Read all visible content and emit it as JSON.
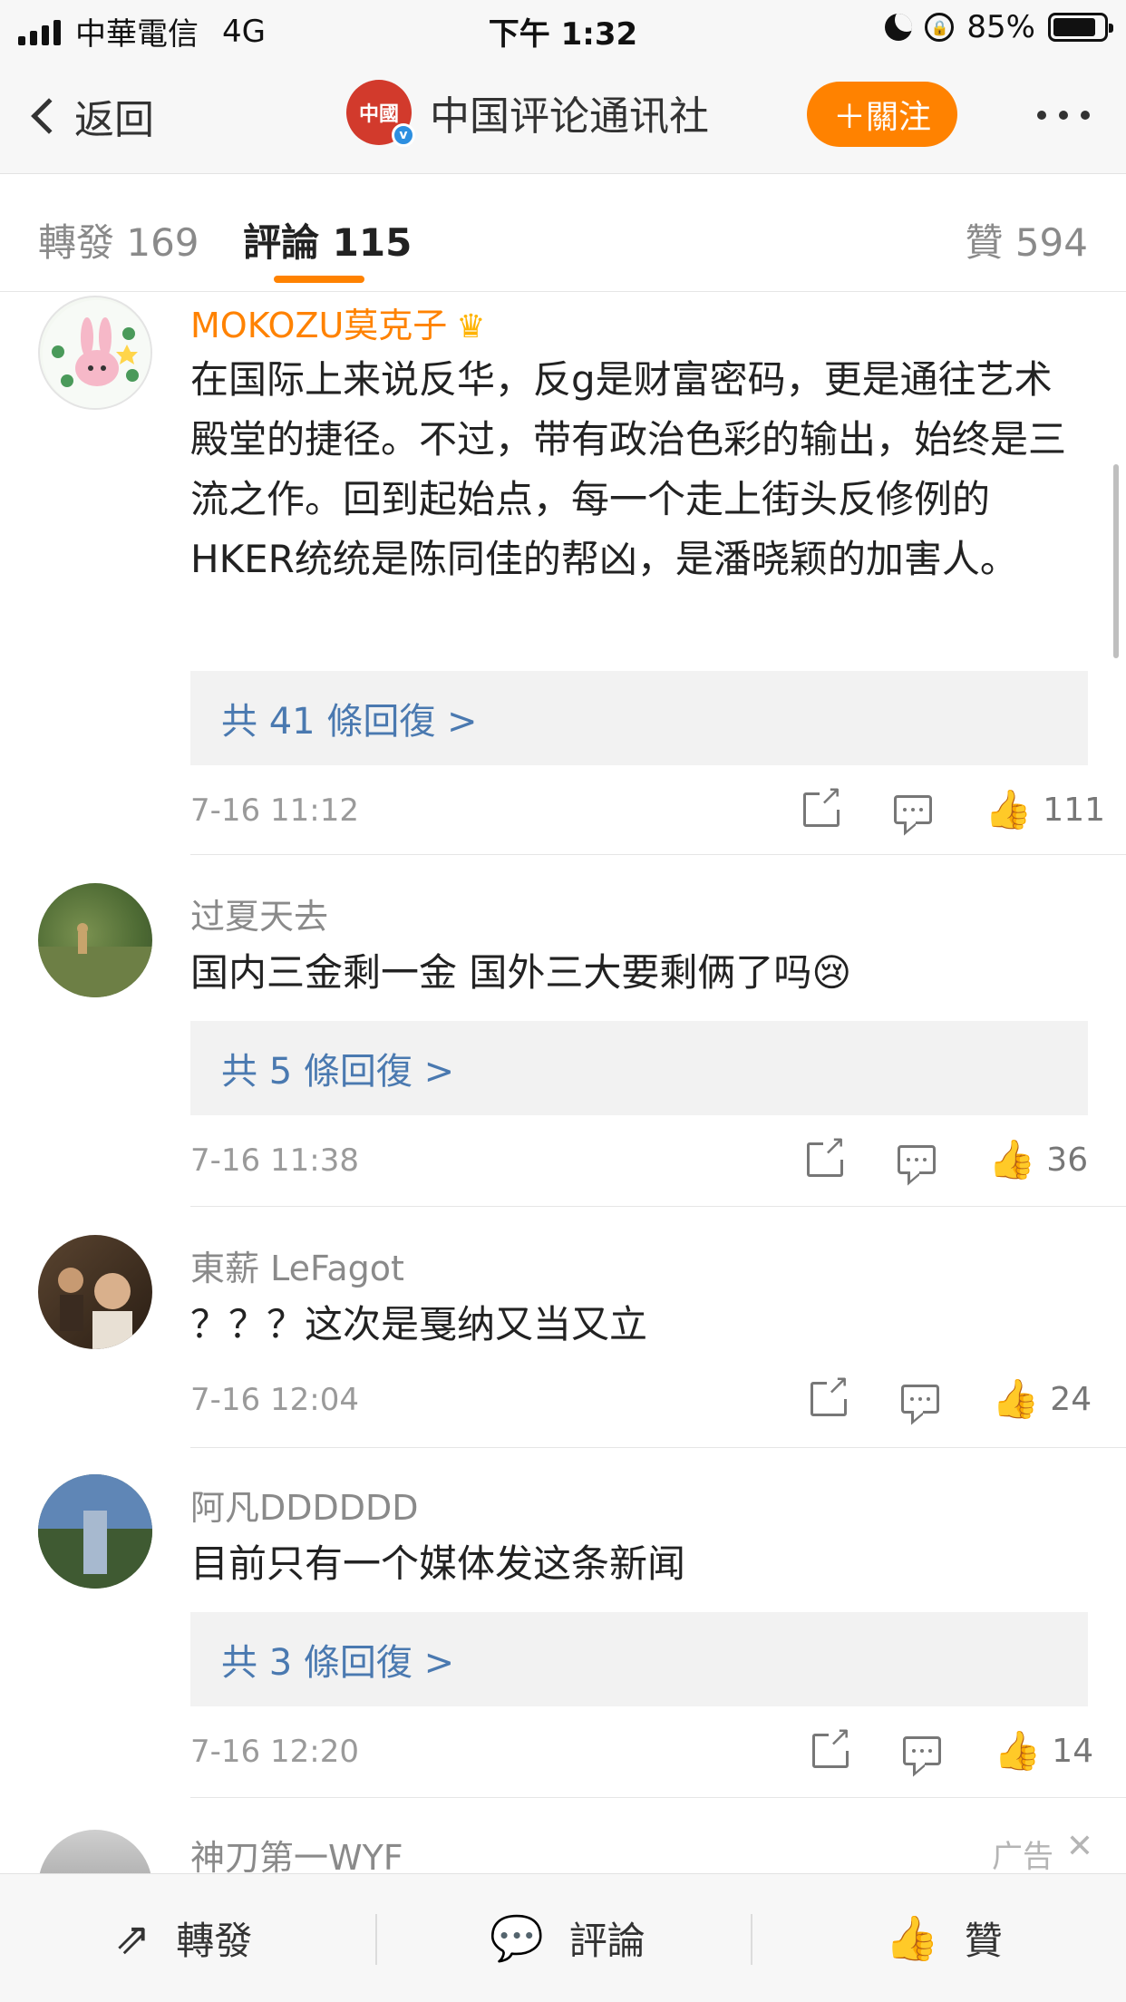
{
  "status_bar": {
    "carrier": "中華電信",
    "network": "4G",
    "time": "下午 1:32",
    "battery": "85%",
    "battery_level": 0.85
  },
  "nav": {
    "back_label": "返回",
    "title": "中国评论通讯社",
    "avatar_text": "中國",
    "follow_label": "＋關注"
  },
  "tabs": {
    "repost": "轉發 169",
    "comments": "評論 115",
    "likes": "贊 594"
  },
  "comments": [
    {
      "user": "MOKOZU莫克子",
      "text": "在国际上来说反华，反g是财富密码，更是通往艺术殿堂的捷径。不过，带有政治色彩的输出，始终是三流之作。回到起始点，每一个走上街头反修例的HKER统统是陈同佳的帮凶，是潘晓颖的加害人。",
      "replies": "共 41 條回復 >",
      "time": "7-16 11:12",
      "likes": "111"
    },
    {
      "user": "过夏天去",
      "text": "国内三金剩一金  国外三大要剩俩了吗😢",
      "replies": "共 5 條回復 >",
      "time": "7-16 11:38",
      "likes": "36"
    },
    {
      "user": "東薪 LeFagot",
      "text": "？？？这次是戛纳又当又立",
      "time": "7-16 12:04",
      "likes": "24"
    },
    {
      "user": "阿凡DDDDDD",
      "text": "目前只有一个媒体发这条新闻",
      "replies": "共 3 條回復 >",
      "time": "7-16 12:20",
      "likes": "14"
    },
    {
      "user": "神刀第一WYF",
      "ad_label": "广告"
    }
  ],
  "bottom_bar": {
    "repost": "轉發",
    "comment": "評論",
    "like": "贊"
  },
  "colors": {
    "accent": "#ff8200",
    "link": "#4a79b0"
  }
}
